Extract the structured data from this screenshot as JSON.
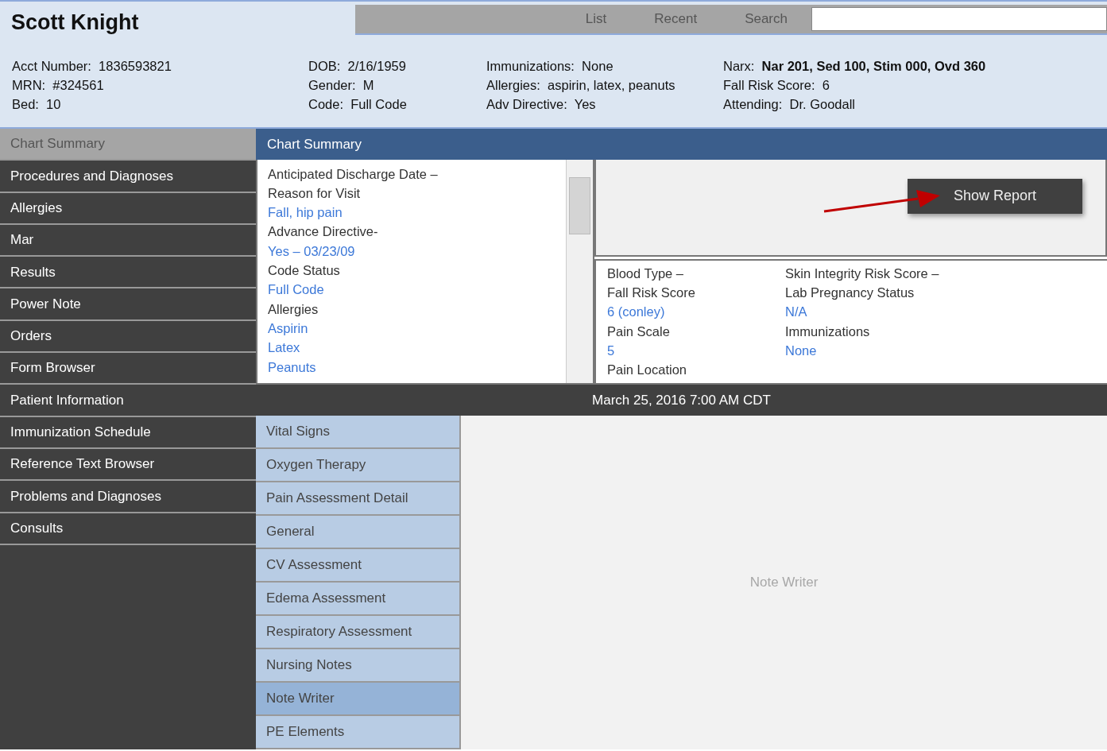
{
  "patient": {
    "name": "Scott Knight",
    "columns": [
      [
        {
          "label": "Acct Number:",
          "value": "1836593821",
          "bold": false
        },
        {
          "label": "MRN:",
          "value": "#324561",
          "bold": false
        },
        {
          "label": "Bed:",
          "value": "10",
          "bold": false
        }
      ],
      [
        {
          "label": "DOB:",
          "value": "2/16/1959",
          "bold": false
        },
        {
          "label": "Gender:",
          "value": "M",
          "bold": false
        },
        {
          "label": "Code:",
          "value": "Full Code",
          "bold": false
        }
      ],
      [
        {
          "label": "Immunizations:",
          "value": "None",
          "bold": false
        },
        {
          "label": "Allergies:",
          "value": "aspirin, latex, peanuts",
          "bold": false
        },
        {
          "label": "Adv Directive:",
          "value": "Yes",
          "bold": false
        }
      ],
      [
        {
          "label": "Narx:",
          "value": "Nar 201, Sed 100, Stim 000, Ovd 360",
          "bold": true
        },
        {
          "label": "Fall Risk Score:",
          "value": "6",
          "bold": false
        },
        {
          "label": "Attending:",
          "value": "Dr. Goodall",
          "bold": false
        }
      ]
    ]
  },
  "top_nav": [
    {
      "label": "List"
    },
    {
      "label": "Recent"
    },
    {
      "label": "Search"
    }
  ],
  "sidebar": {
    "items": [
      {
        "label": "Chart Summary",
        "selected": true
      },
      {
        "label": "Procedures and Diagnoses",
        "selected": false
      },
      {
        "label": "Allergies",
        "selected": false
      },
      {
        "label": "Mar",
        "selected": false
      },
      {
        "label": "Results",
        "selected": false
      },
      {
        "label": "Power Note",
        "selected": false
      },
      {
        "label": "Orders",
        "selected": false
      },
      {
        "label": "Form Browser",
        "selected": false
      },
      {
        "label": "Patient Information",
        "selected": false
      },
      {
        "label": "Immunization Schedule",
        "selected": false
      },
      {
        "label": "Reference Text Browser",
        "selected": false
      },
      {
        "label": "Problems and Diagnoses",
        "selected": false
      },
      {
        "label": "Consults",
        "selected": false
      }
    ]
  },
  "main_title": "Chart Summary",
  "summary_list": [
    {
      "text": "Anticipated Discharge Date –",
      "kind": "label"
    },
    {
      "text": "Reason for Visit",
      "kind": "label"
    },
    {
      "text": "Fall, hip pain",
      "kind": "value"
    },
    {
      "text": "Advance Directive-",
      "kind": "label"
    },
    {
      "text": "Yes – 03/23/09",
      "kind": "value"
    },
    {
      "text": "Code Status",
      "kind": "label"
    },
    {
      "text": "Full Code",
      "kind": "value"
    },
    {
      "text": "Allergies",
      "kind": "label"
    },
    {
      "text": "Aspirin",
      "kind": "value"
    },
    {
      "text": "Latex",
      "kind": "value"
    },
    {
      "text": "Peanuts",
      "kind": "value"
    }
  ],
  "report_button": "Show Report",
  "details": [
    [
      {
        "text": "Blood Type –",
        "kind": "label"
      },
      {
        "text": "Fall Risk Score",
        "kind": "label"
      },
      {
        "text": "6 (conley)",
        "kind": "value"
      },
      {
        "text": "Pain Scale",
        "kind": "label"
      },
      {
        "text": "5",
        "kind": "value"
      },
      {
        "text": "Pain Location",
        "kind": "label"
      }
    ],
    [
      {
        "text": "Skin Integrity Risk Score –",
        "kind": "label"
      },
      {
        "text": "Lab Pregnancy Status",
        "kind": "label"
      },
      {
        "text": "N/A",
        "kind": "value"
      },
      {
        "text": "Immunizations",
        "kind": "label"
      },
      {
        "text": "None",
        "kind": "value"
      }
    ]
  ],
  "date_bar": "March 25, 2016 7:00 AM CDT",
  "note_sections": [
    {
      "label": "Vital Signs",
      "selected": false
    },
    {
      "label": "Oxygen Therapy",
      "selected": false
    },
    {
      "label": "Pain Assessment Detail",
      "selected": false
    },
    {
      "label": "General",
      "selected": false
    },
    {
      "label": "CV Assessment",
      "selected": false
    },
    {
      "label": "Edema Assessment",
      "selected": false
    },
    {
      "label": "Respiratory Assessment",
      "selected": false
    },
    {
      "label": "Nursing Notes",
      "selected": false
    },
    {
      "label": "Note Writer",
      "selected": true
    },
    {
      "label": "PE Elements",
      "selected": false
    }
  ],
  "note_area_label": "Note Writer"
}
